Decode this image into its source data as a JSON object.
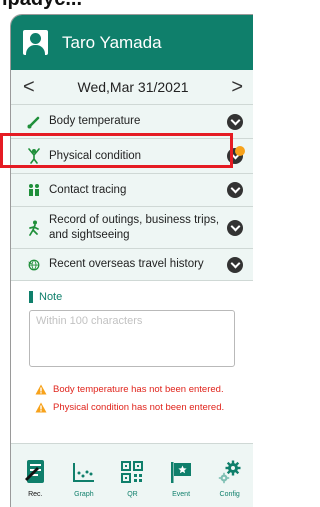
{
  "top_cut_text": "ipadyc...",
  "header": {
    "user_name": "Taro Yamada"
  },
  "datebar": {
    "prev": "<",
    "date": "Wed,Mar 31/2021",
    "next": ">"
  },
  "rows": [
    {
      "label": "Body temperature",
      "icon": "thermometer-icon"
    },
    {
      "label": "Physical condition",
      "icon": "person-stretch-icon"
    },
    {
      "label": "Contact tracing",
      "icon": "two-people-icon"
    },
    {
      "label": "Record of outings, business trips, and sightseeing",
      "icon": "walking-person-icon"
    },
    {
      "label": "Recent overseas travel history",
      "icon": "globe-plane-icon"
    }
  ],
  "note": {
    "title": "Note",
    "placeholder": "Within 100 characters",
    "value": ""
  },
  "warnings": [
    "Body temperature has not been entered.",
    "Physical condition has not been entered."
  ],
  "tabs": [
    {
      "label": "Rec.",
      "icon": "record-icon"
    },
    {
      "label": "Graph",
      "icon": "graph-icon"
    },
    {
      "label": "QR",
      "icon": "qr-icon"
    },
    {
      "label": "Event",
      "icon": "event-icon"
    },
    {
      "label": "Config",
      "icon": "gear-icon"
    }
  ],
  "colors": {
    "brand": "#0f7f6b",
    "highlight": "#e51b23",
    "indicator": "#f7a21b",
    "warning": "#e0241c"
  }
}
